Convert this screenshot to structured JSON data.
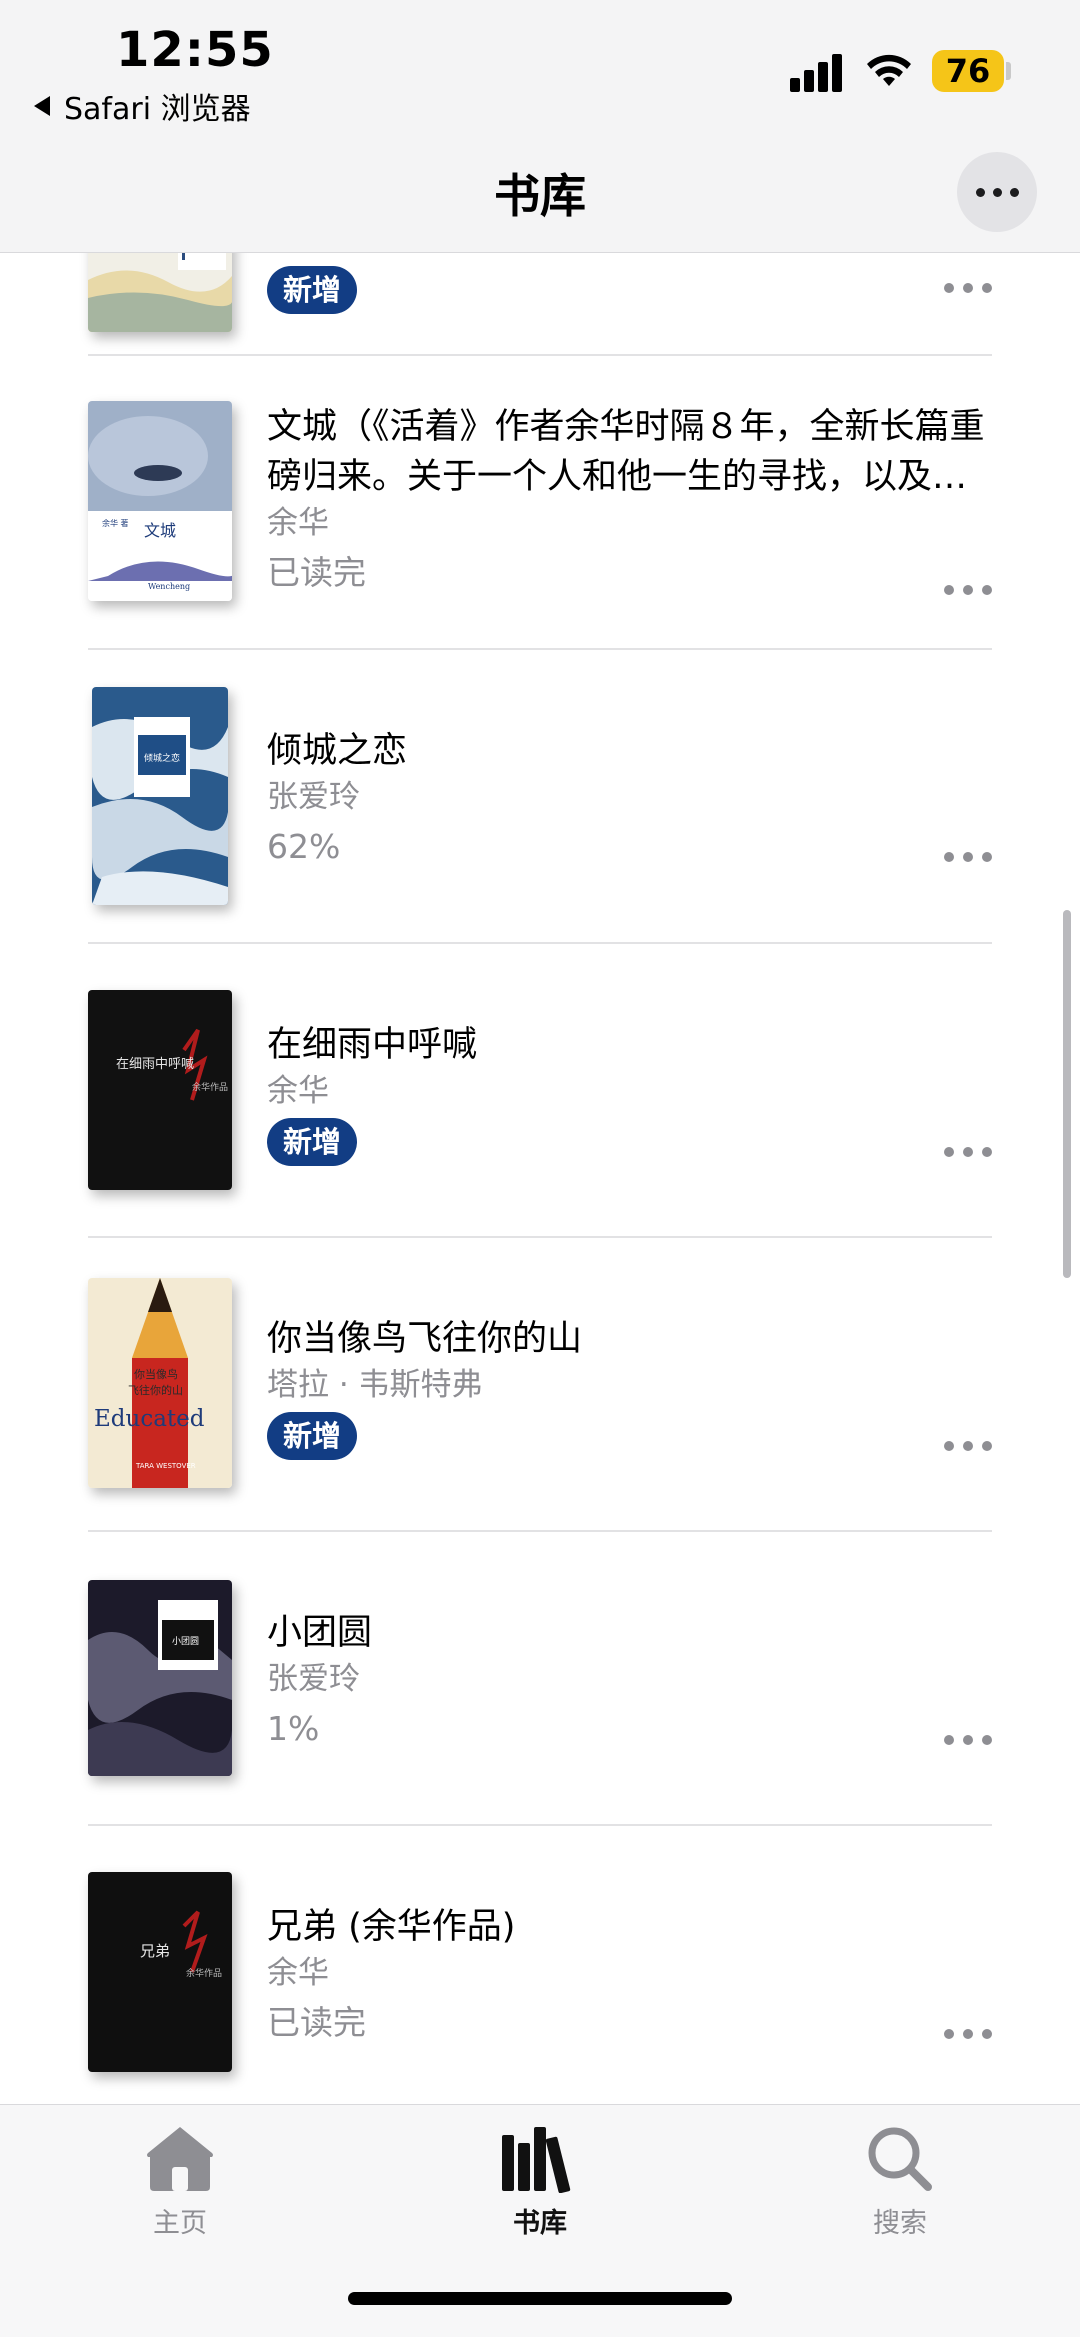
{
  "status_bar": {
    "time": "12:55",
    "back_app": "Safari 浏览器",
    "battery": "76"
  },
  "nav": {
    "title": "书库"
  },
  "books": [
    {
      "title": "",
      "author": "",
      "badge": "新增",
      "status": ""
    },
    {
      "title": "文城（《活着》作者余华时隔８年，全新长篇重磅归来。关于一个人和他一生的寻找，以及…",
      "author": "余华",
      "status": "已读完"
    },
    {
      "title": "倾城之恋",
      "author": "张爱玲",
      "status": "62%"
    },
    {
      "title": "在细雨中呼喊",
      "author": "余华",
      "badge": "新增"
    },
    {
      "title": "你当像鸟飞往你的山",
      "author": "塔拉 · 韦斯特弗",
      "badge": "新增"
    },
    {
      "title": "小团圆",
      "author": "张爱玲",
      "status": "1%"
    },
    {
      "title": "兄弟 (余华作品)",
      "author": "余华",
      "status": "已读完"
    }
  ],
  "covers": {
    "wencheng": {
      "author": "余华 著",
      "title": "文城",
      "en": "Wencheng"
    },
    "qingcheng": {
      "title": "倾城之恋"
    },
    "xiyu": {
      "title": "在细雨中呼喊",
      "series": "余华作品"
    },
    "educated": {
      "cn1": "你当像鸟",
      "cn2": "飞往你的山",
      "en": "Educated",
      "author": "TARA WESTOVER"
    },
    "xiaotuanyuan": {
      "title": "小团圆"
    },
    "xiongdi": {
      "title": "兄弟",
      "series": "余华作品"
    }
  },
  "tabs": [
    {
      "label": "主页",
      "icon": "home-icon",
      "active": false
    },
    {
      "label": "书库",
      "icon": "library-icon",
      "active": true
    },
    {
      "label": "搜索",
      "icon": "search-icon",
      "active": false
    }
  ],
  "colors": {
    "badge": "#123d84",
    "battery": "#f5c518",
    "secondary_text": "#8e8e93"
  }
}
